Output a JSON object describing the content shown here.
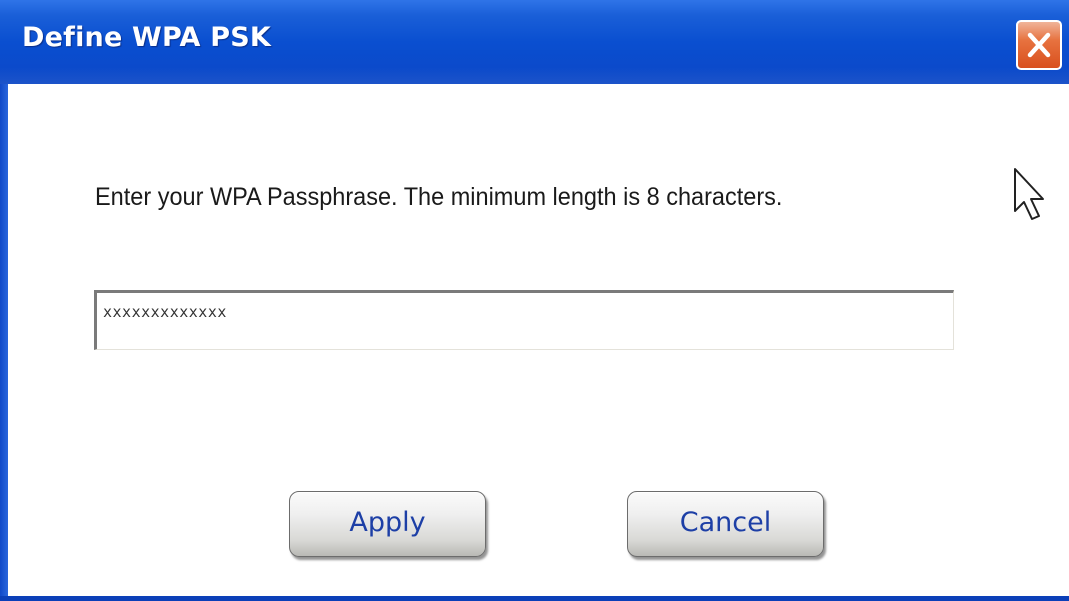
{
  "window": {
    "title": "Define WPA PSK"
  },
  "dialog": {
    "prompt": "Enter your WPA Passphrase.  The minimum length is 8 characters.",
    "passphrase_value": "xxxxxxxxxxxxx"
  },
  "buttons": {
    "apply_label": "Apply",
    "cancel_label": "Cancel"
  },
  "icons": {
    "close": "close-icon",
    "cursor": "mouse-pointer-icon"
  },
  "colors": {
    "titlebar": "#0a4fd0",
    "close_button": "#e7723f",
    "button_text": "#1d3fa6"
  }
}
